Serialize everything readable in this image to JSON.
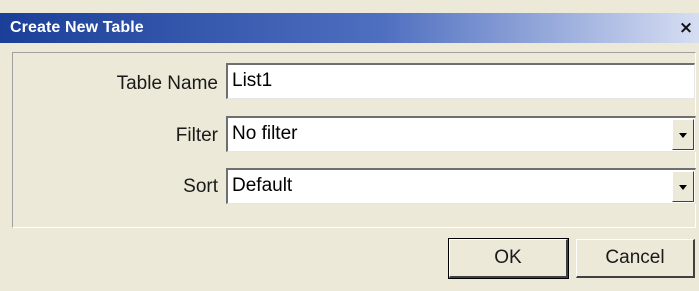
{
  "dialog": {
    "title": "Create New Table",
    "close_glyph": "×"
  },
  "form": {
    "table_name": {
      "label": "Table Name",
      "value": "List1"
    },
    "filter": {
      "label": "Filter",
      "value": "No filter"
    },
    "sort": {
      "label": "Sort",
      "value": "Default"
    }
  },
  "buttons": {
    "ok_label": "OK",
    "cancel_label": "Cancel"
  },
  "icons": {
    "close": "close-icon",
    "dropdown": "chevron-down-icon"
  },
  "colors": {
    "titlebar_start": "#1b3f98",
    "dialog_background": "#ece9d8"
  }
}
